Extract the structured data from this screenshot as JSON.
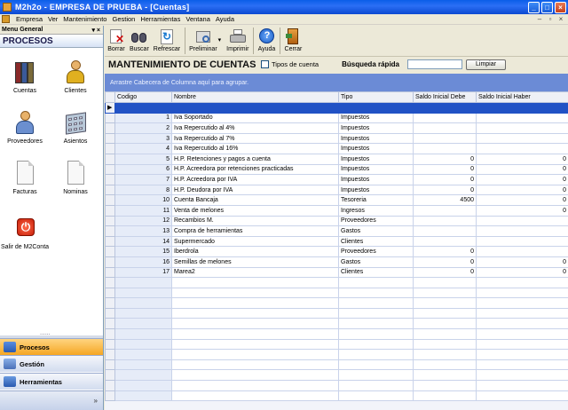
{
  "window": {
    "title": "M2h2o - EMPRESA DE PRUEBA - [Cuentas]",
    "minimize": "_",
    "maximize": "□",
    "close": "×"
  },
  "menu": {
    "items": [
      "Empresa",
      "Ver",
      "Mantenimiento",
      "Gestion",
      "Herramientas",
      "Ventana",
      "Ayuda"
    ],
    "mdi_controls": [
      "–",
      "▫",
      "×"
    ]
  },
  "left_panel": {
    "header": "Menu General",
    "pin": "▾ ×",
    "section": "PROCESOS",
    "icons": [
      {
        "label": "Cuentas",
        "icon": "books-icon"
      },
      {
        "label": "Clientes",
        "icon": "person-icon"
      },
      {
        "label": "Proveedores",
        "icon": "supplier-icon"
      },
      {
        "label": "Asientos",
        "icon": "calculator-icon"
      },
      {
        "label": "Facturas",
        "icon": "document-icon"
      },
      {
        "label": "Nominas",
        "icon": "document-icon"
      },
      {
        "label": "Salir de M2Conta",
        "icon": "power-icon"
      }
    ],
    "nav": [
      {
        "label": "Procesos",
        "active": true
      },
      {
        "label": "Gestión",
        "active": false
      },
      {
        "label": "Herramientas",
        "active": false
      }
    ],
    "footer_chevron": "»"
  },
  "toolbar": {
    "buttons": [
      "Borrar",
      "Buscar",
      "Refrescar",
      "Preliminar",
      "Imprimir",
      "Ayuda",
      "Cerrar"
    ],
    "dropdown_arrow": "▾"
  },
  "form": {
    "title": "MANTENIMIENTO DE CUENTAS",
    "checkbox_label": "Tipos de cuenta",
    "quick_search_label": "Búsqueda rápida",
    "quick_search_value": "",
    "clear_button": "Limpiar"
  },
  "group_panel": {
    "text": "Arrastre Cabecera de Columna aquí para agrupar."
  },
  "grid": {
    "columns": [
      "Codigo",
      "Nombre",
      "Tipo",
      "Saldo Inicial Debe",
      "Saldo Inicial Haber"
    ],
    "row_indicator": "▶",
    "rows": [
      [
        "1",
        "Iva Soportado",
        "Impuestos",
        "",
        ""
      ],
      [
        "2",
        "Iva Repercutido al 4%",
        "Impuestos",
        "",
        ""
      ],
      [
        "3",
        "Iva Repercutido al 7%",
        "Impuestos",
        "",
        ""
      ],
      [
        "4",
        "Iva Repercutido al 16%",
        "Impuestos",
        "",
        ""
      ],
      [
        "5",
        "H.P. Retenciones y pagos a cuenta",
        "Impuestos",
        "0",
        "0"
      ],
      [
        "6",
        "H.P. Acreedora por retenciones practicadas",
        "Impuestos",
        "0",
        "0"
      ],
      [
        "7",
        "H.P. Acreedora por IVA",
        "Impuestos",
        "0",
        "0"
      ],
      [
        "8",
        "H.P. Deudora por IVA",
        "Impuestos",
        "0",
        "0"
      ],
      [
        "10",
        "Cuenta Bancaja",
        "Tesoreria",
        "4500",
        "0"
      ],
      [
        "11",
        "Venta de melones",
        "Ingresos",
        "",
        "0"
      ],
      [
        "12",
        "Recambios M.",
        "Proveedores",
        "",
        ""
      ],
      [
        "13",
        "Compra de herramientas",
        "Gastos",
        "",
        ""
      ],
      [
        "14",
        "Supermercado",
        "Clientes",
        "",
        ""
      ],
      [
        "15",
        "Iberdrola",
        "Proveedores",
        "0",
        ""
      ],
      [
        "16",
        "Semillas de melones",
        "Gastos",
        "0",
        "0"
      ],
      [
        "17",
        "Marea2",
        "Clientes",
        "0",
        "0"
      ]
    ],
    "empty_rows": 12
  },
  "colors": {
    "titlebar": "#0b49d1",
    "group_panel": "#6b8bd6",
    "filter_row": "#2152c5",
    "active_nav": "#f5a623"
  }
}
